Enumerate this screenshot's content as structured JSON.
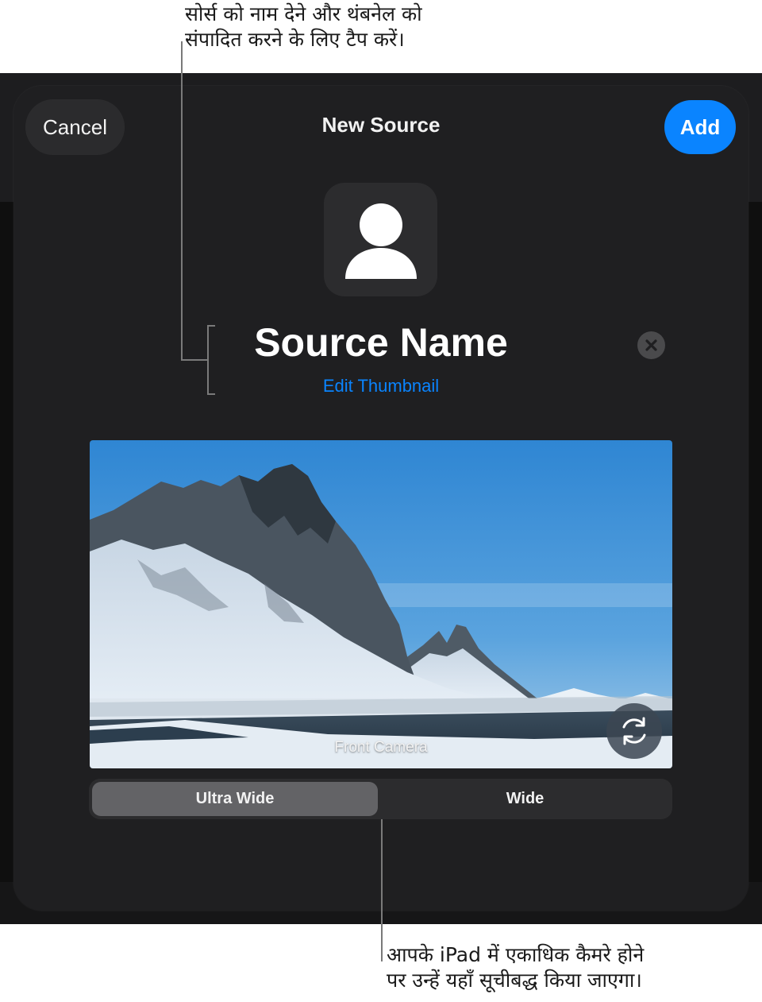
{
  "annotations": {
    "top_callout": [
      "सोर्स को नाम देने और थंबनेल को",
      "संपादित करने के लिए टैप करें।"
    ],
    "bottom_callout": [
      "आपके iPad में एकाधिक कैमरे होने",
      "पर उन्हें यहाँ सूचीबद्ध किया जाएगा।"
    ]
  },
  "sheet": {
    "cancel_label": "Cancel",
    "title": "New Source",
    "add_label": "Add"
  },
  "source": {
    "thumbnail_icon": "person-icon",
    "name": "Source Name",
    "clear_icon": "xmark-circle-icon",
    "edit_thumbnail_label": "Edit Thumbnail"
  },
  "camera": {
    "preview_label": "Front Camera",
    "flip_icon": "camera-rotate-icon",
    "lenses": [
      {
        "label": "Ultra Wide",
        "selected": true
      },
      {
        "label": "Wide",
        "selected": false
      }
    ]
  },
  "colors": {
    "accent": "#0a84ff",
    "sheet_background": "#1f1f21",
    "segment_selected": "#636366"
  }
}
